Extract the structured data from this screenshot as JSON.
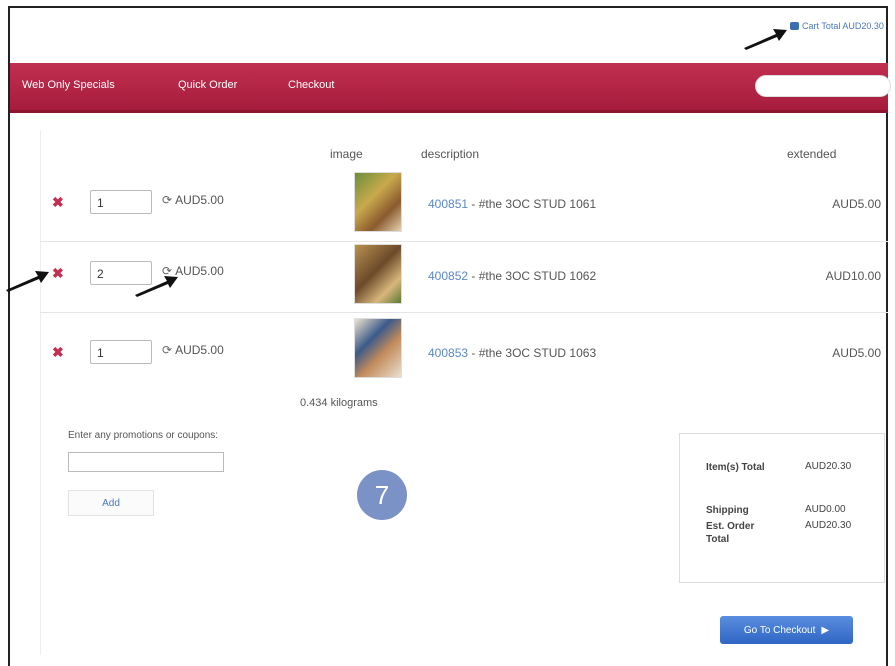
{
  "header": {
    "cart_link": "Cart Total AUD20.30"
  },
  "nav": {
    "items": [
      "Web Only Specials",
      "Quick Order",
      "Checkout"
    ],
    "search_placeholder": ""
  },
  "table": {
    "headers": {
      "image": "image",
      "description": "description",
      "extended": "extended"
    },
    "rows": [
      {
        "qty": "1",
        "price": "AUD5.00",
        "sku": "400851",
        "name": "- #the 3OC STUD 1061",
        "extended": "AUD5.00"
      },
      {
        "qty": "2",
        "price": "AUD5.00",
        "sku": "400852",
        "name": "- #the 3OC STUD 1062",
        "extended": "AUD10.00"
      },
      {
        "qty": "1",
        "price": "AUD5.00",
        "sku": "400853",
        "name": "- #the 3OC STUD 1063",
        "extended": "AUD5.00"
      }
    ],
    "weight": "0.434 kilograms"
  },
  "promo": {
    "label": "Enter any promotions or coupons:",
    "value": "",
    "add_label": "Add"
  },
  "badge": "7",
  "summary": {
    "item_total_label": "Item(s) Total",
    "item_total_value": "AUD20.30",
    "shipping_label": "Shipping",
    "shipping_value": "AUD0.00",
    "est_total_label": "Est. Order Total",
    "est_total_value": "AUD20.30"
  },
  "checkout_button": "Go To Checkout",
  "colors": {
    "nav": "#b3244a",
    "link": "#5b88c4",
    "badge": "#7b92c7",
    "button": "#3a72d0"
  }
}
